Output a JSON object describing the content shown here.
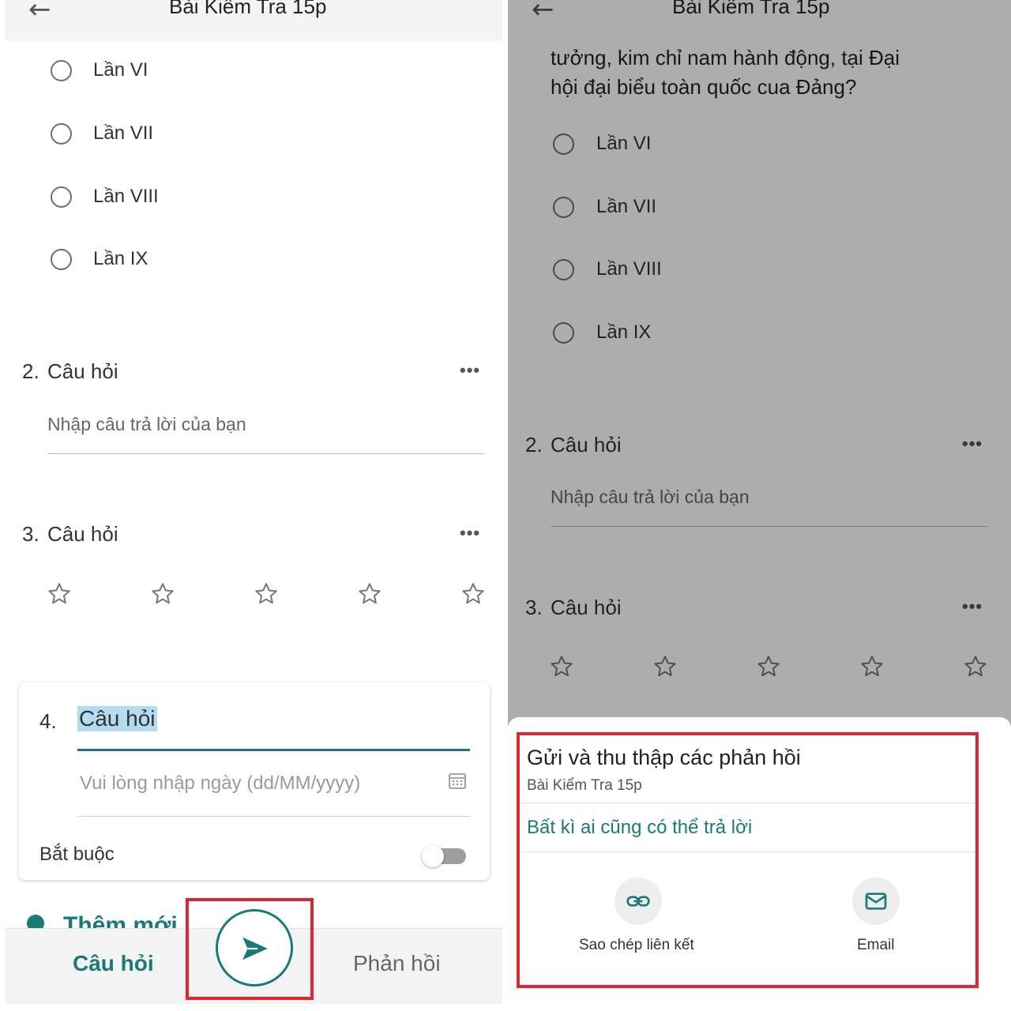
{
  "colors": {
    "accent": "#1a7a78",
    "highlight": "#e0262e",
    "selection": "#b3dcf0"
  },
  "left": {
    "header": {
      "back_icon": "arrow-left-icon",
      "title": "Bài Kiểm Tra 15p"
    },
    "q1_options": [
      "Lần VI",
      "Lần VII",
      "Lần VIII",
      "Lần IX"
    ],
    "q2": {
      "number": "2.",
      "title": "Câu hỏi",
      "more": "•••",
      "placeholder": "Nhập câu trả lời của bạn"
    },
    "q3": {
      "number": "3.",
      "title": "Câu hỏi",
      "more": "•••",
      "stars": 5
    },
    "q4_card": {
      "number": "4.",
      "title": "Câu hỏi",
      "date_placeholder": "Vui lòng nhập ngày (dd/MM/yyyy)",
      "required_label": "Bắt buộc",
      "calendar_icon": "calendar-icon"
    },
    "add_new_partial": "Thêm mới",
    "bottom_nav": {
      "questions": "Câu hỏi",
      "send_icon": "send-icon",
      "responses": "Phản hồi"
    }
  },
  "right": {
    "header": {
      "back_icon": "arrow-left-icon",
      "title": "Bài Kiểm Tra 15p"
    },
    "q1_text_line1": "tưởng, kim chỉ nam hành động, tại Đại",
    "q1_text_line2": "hội đại biểu toàn quốc cua Đảng?",
    "q1_options": [
      "Lần VI",
      "Lần VII",
      "Lần VIII",
      "Lần IX"
    ],
    "q2": {
      "number": "2.",
      "title": "Câu hỏi",
      "more": "•••",
      "placeholder": "Nhập câu trả lời của bạn"
    },
    "q3": {
      "number": "3.",
      "title": "Câu hỏi",
      "more": "•••",
      "stars": 5
    },
    "share_sheet": {
      "title": "Gửi và thu thập các phản hồi",
      "subtitle": "Bài Kiểm Tra 15p",
      "audience": "Bất kì ai cũng có thể trả lời",
      "copy_link_label": "Sao chép liên kết",
      "email_label": "Email"
    }
  }
}
